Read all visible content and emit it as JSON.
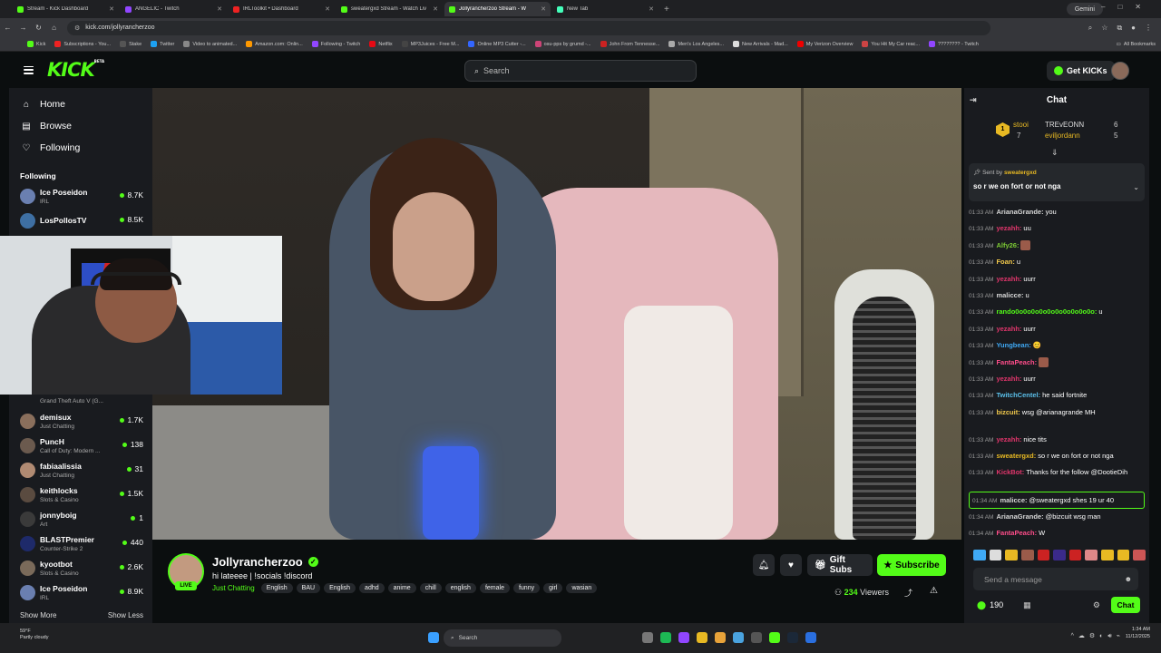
{
  "browser": {
    "tabs": [
      {
        "title": "Stream - Kick Dashboard",
        "color": "#53fc18"
      },
      {
        "title": "ANGELIC - Twitch",
        "color": "#9146ff"
      },
      {
        "title": "IRLToolkit • Dashboard",
        "color": "#e22"
      },
      {
        "title": "sweatergxd Stream - Watch Liv",
        "color": "#53fc18"
      },
      {
        "title": "Jollyrancherzoo Stream - W",
        "color": "#53fc18"
      },
      {
        "title": "New Tab",
        "color": "#4fb"
      }
    ],
    "gemini": "Gemini",
    "url": "kick.com/jollyrancherzoo",
    "bookmarks": [
      "Kick",
      "Subscriptions - You...",
      "Stake",
      "Twitter",
      "Video to animated...",
      "Amazon.com: Onlin...",
      "Following - Twitch",
      "Netflix",
      "MP3Juices - Free M...",
      "Online MP3 Cutter -...",
      "osu-pps by grumd -...",
      "John From Tennesse...",
      "Men's Los Angeles...",
      "New Arrivals - Mad...",
      "My Verizon Overview",
      "You Hit My Car reac...",
      "???????? - Twitch"
    ],
    "all_bookmarks": "All Bookmarks"
  },
  "header": {
    "logo": "KICK",
    "logo_beta": "BETA",
    "search_placeholder": "Search",
    "get_kicks": "Get KICKs"
  },
  "sidebar": {
    "nav": [
      {
        "label": "Home",
        "icon": "⌂"
      },
      {
        "label": "Browse",
        "icon": "▤"
      },
      {
        "label": "Following",
        "icon": "♡"
      }
    ],
    "following_title": "Following",
    "channels_top": [
      {
        "name": "Ice Poseidon",
        "cat": "IRL",
        "viewers": "8.7K",
        "color": "#6a7fb0"
      },
      {
        "name": "LosPollosTV",
        "cat": "",
        "viewers": "8.5K",
        "color": "#3e6fa3"
      }
    ],
    "partial_cat": "Grand Theft Auto V (G...",
    "channels": [
      {
        "name": "demisux",
        "cat": "Just Chatting",
        "viewers": "1.7K",
        "color": "#8a6f5c"
      },
      {
        "name": "PuncH",
        "cat": "Call of Duty: Modern ...",
        "viewers": "138",
        "color": "#6b5a4e"
      },
      {
        "name": "fabiaalissia",
        "cat": "Just Chatting",
        "viewers": "31",
        "color": "#b08a72"
      },
      {
        "name": "keithlocks",
        "cat": "Slots & Casino",
        "viewers": "1.5K",
        "color": "#5a4b40"
      },
      {
        "name": "jonnyboig",
        "cat": "Art",
        "viewers": "1",
        "color": "#3a3a3a"
      },
      {
        "name": "BLASTPremier",
        "cat": "Counter-Strike 2",
        "viewers": "440",
        "color": "#1e2a6a"
      },
      {
        "name": "kyootbot",
        "cat": "Slots & Casino",
        "viewers": "2.6K",
        "color": "#7a6a5a"
      },
      {
        "name": "Ice Poseidon",
        "cat": "IRL",
        "viewers": "8.9K",
        "color": "#6a7fb0"
      }
    ],
    "show_more": "Show More",
    "show_less": "Show Less"
  },
  "stream": {
    "name": "Jollyrancherzoo",
    "title": "hi lateeee | !socials !discord",
    "category": "Just Chatting",
    "tags": [
      "English",
      "BAU",
      "English",
      "adhd",
      "anime",
      "chill",
      "english",
      "female",
      "funny",
      "girl",
      "wasian"
    ],
    "live": "LIVE",
    "gift_subs": "Gift Subs",
    "subscribe": "Subscribe",
    "viewers": "234",
    "viewers_label": "Viewers"
  },
  "chat": {
    "title": "Chat",
    "leaderboard": [
      {
        "rank": "1",
        "name": "stooi",
        "score": "7"
      },
      {
        "name": "TREvEONN",
        "score": "6"
      },
      {
        "name": "eviljordann",
        "score": "5"
      }
    ],
    "pinned_by_label": "Sent by",
    "pinned_by": "sweatergxd",
    "pinned_text": "so r we on fort or not nga",
    "messages": [
      {
        "t": "01:33 AM",
        "u": "ArianaGrande:",
        "c": "#d7d7d7",
        "m": "you"
      },
      {
        "t": "01:33 AM",
        "u": "yezahh:",
        "c": "#e0356b",
        "m": "uu"
      },
      {
        "t": "01:33 AM",
        "u": "Alfy26:",
        "c": "#7dcc34",
        "m": "",
        "emote": true
      },
      {
        "t": "01:33 AM",
        "u": "Foan:",
        "c": "#f2c94c",
        "m": "u"
      },
      {
        "t": "01:33 AM",
        "u": "yezahh:",
        "c": "#e0356b",
        "m": "uurr"
      },
      {
        "t": "01:33 AM",
        "u": "malicce:",
        "c": "#d7d7d7",
        "m": "u"
      },
      {
        "t": "01:33 AM",
        "u": "rando0o0o0o0o0o0o0o0o0o0o:",
        "c": "#53fc18",
        "m": "u"
      },
      {
        "t": "01:33 AM",
        "u": "yezahh:",
        "c": "#e0356b",
        "m": "uurr"
      },
      {
        "t": "01:33 AM",
        "u": "Yungbean:",
        "c": "#3fa9f5",
        "m": "😊"
      },
      {
        "t": "01:33 AM",
        "u": "FantaPeach:",
        "c": "#ff4d8a",
        "m": "",
        "emote": true
      },
      {
        "t": "01:33 AM",
        "u": "yezahh:",
        "c": "#e0356b",
        "m": "uurr"
      },
      {
        "t": "01:33 AM",
        "u": "TwitchCentel:",
        "c": "#5bc0eb",
        "m": "he said fortnite"
      },
      {
        "t": "01:33 AM",
        "u": "bizcuit:",
        "c": "#f2c94c",
        "m": "wsg @arianagrande MH",
        "tall": true
      },
      {
        "t": "01:33 AM",
        "u": "yezahh:",
        "c": "#e0356b",
        "m": "nice tits"
      },
      {
        "t": "01:33 AM",
        "u": "sweatergxd:",
        "c": "#e8b923",
        "m": "so r we on fort or not nga"
      },
      {
        "t": "01:33 AM",
        "u": "KickBot:",
        "c": "#e0356b",
        "m": "Thanks for the follow @DootieDih",
        "tall": true
      },
      {
        "t": "01:34 AM",
        "u": "malicce:",
        "c": "#d7d7d7",
        "m": "@sweatergxd shes 19 ur 40",
        "hl": true
      },
      {
        "t": "01:34 AM",
        "u": "ArianaGrande:",
        "c": "#d7d7d7",
        "m": "@bizcuit wsg man"
      },
      {
        "t": "01:34 AM",
        "u": "FantaPeach:",
        "c": "#ff4d8a",
        "m": "W"
      }
    ],
    "send_placeholder": "Send a message",
    "points": "190",
    "chat_button": "Chat"
  },
  "taskbar": {
    "weather_temp": "59°F",
    "weather_desc": "Partly cloudy",
    "search": "Search",
    "time": "1:34 AM",
    "date": "11/12/2025"
  }
}
